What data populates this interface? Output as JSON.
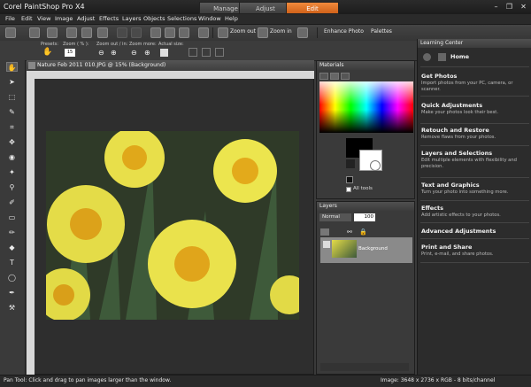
{
  "app": {
    "title": "Corel PaintShop Pro X4",
    "modes": [
      "Manage",
      "Adjust",
      "Edit"
    ],
    "active_mode": "Edit"
  },
  "menu": [
    "File",
    "Edit",
    "View",
    "Image",
    "Adjust",
    "Effects",
    "Layers",
    "Objects",
    "Selections",
    "Window",
    "Help"
  ],
  "toolbar": {
    "zoom_out": "Zoom out",
    "zoom_in": "Zoom in",
    "enhance_photo": "Enhance Photo",
    "palettes": "Palettes"
  },
  "options": {
    "presets_label": "Presets:",
    "zoom_pct_label": "Zoom ( % ):",
    "zoom_pct_value": "15",
    "zoom_out_in_label": "Zoom out / in:",
    "zoom_more_label": "Zoom more:",
    "actual_size_label": "Actual size:"
  },
  "document": {
    "title": "Nature Feb 2011 010.JPG @  15% (Background)"
  },
  "materials": {
    "title": "Materials",
    "all_tools": "All tools"
  },
  "layers": {
    "title": "Layers",
    "blend_mode": "Normal",
    "opacity": "100",
    "layer_name": "Background"
  },
  "learning_center": {
    "title": "Learning Center",
    "home": "Home",
    "sections": [
      {
        "title": "Get Photos",
        "desc": "Import photos from your PC, camera, or scanner."
      },
      {
        "title": "Quick Adjustments",
        "desc": "Make your photos look their best."
      },
      {
        "title": "Retouch and Restore",
        "desc": "Remove flaws from your photos."
      },
      {
        "title": "Layers and Selections",
        "desc": "Edit multiple elements with flexibility and precision."
      },
      {
        "title": "Text and Graphics",
        "desc": "Turn your photo into something more."
      },
      {
        "title": "Effects",
        "desc": "Add artistic effects to your photos."
      },
      {
        "title": "Advanced Adjustments",
        "desc": ""
      },
      {
        "title": "Print and Share",
        "desc": "Print, e-mail, and share photos."
      }
    ]
  },
  "status": {
    "hint": "Pan Tool: Click and drag to pan images larger than the window.",
    "image_info": "Image:  3648 x 2736 x RGB - 8 bits/channel"
  },
  "colors": {
    "accent_orange": "#e8782a",
    "background": "#3a3a3a"
  }
}
